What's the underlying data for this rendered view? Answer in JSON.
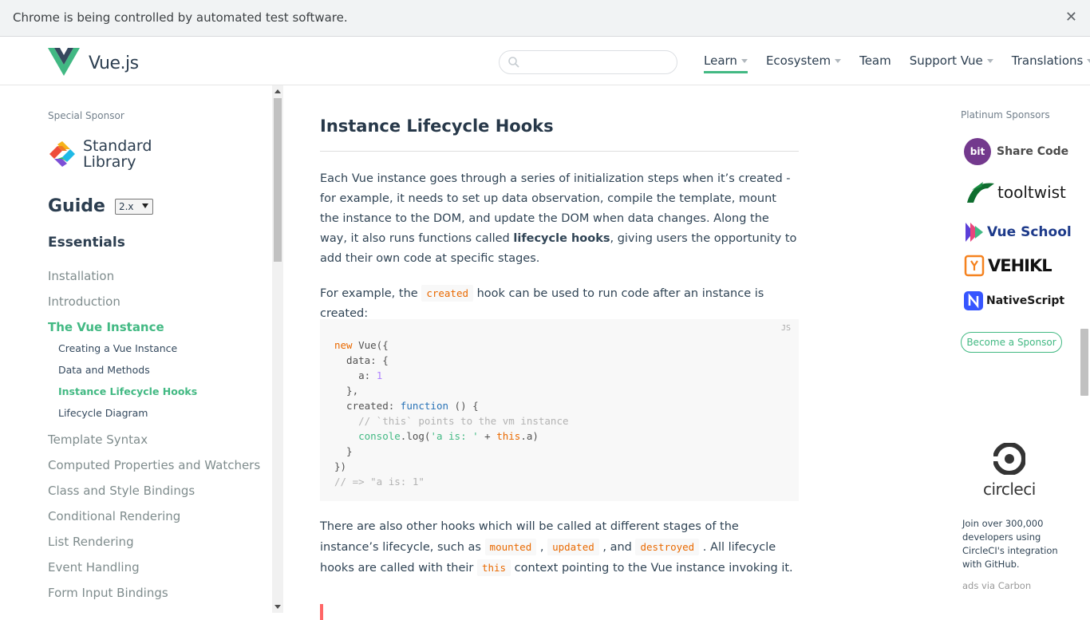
{
  "infobar": {
    "message": "Chrome is being controlled by automated test software.",
    "close_icon": "close-icon"
  },
  "header": {
    "brand": "Vue.js",
    "search": {
      "placeholder": "",
      "value": ""
    },
    "nav": [
      {
        "label": "Learn",
        "has_dropdown": true,
        "active": true
      },
      {
        "label": "Ecosystem",
        "has_dropdown": true
      },
      {
        "label": "Team",
        "has_dropdown": false
      },
      {
        "label": "Support Vue",
        "has_dropdown": true
      },
      {
        "label": "Translations",
        "has_dropdown": true
      }
    ]
  },
  "sidebar": {
    "special_sponsor_label": "Special Sponsor",
    "sponsor_name_line1": "Standard",
    "sponsor_name_line2": "Library",
    "guide_title": "Guide",
    "version": "2.x",
    "section_title": "Essentials",
    "items": [
      {
        "label": "Installation"
      },
      {
        "label": "Introduction"
      },
      {
        "label": "The Vue Instance",
        "active": true,
        "children": [
          {
            "label": "Creating a Vue Instance"
          },
          {
            "label": "Data and Methods"
          },
          {
            "label": "Instance Lifecycle Hooks",
            "active": true
          },
          {
            "label": "Lifecycle Diagram"
          }
        ]
      },
      {
        "label": "Template Syntax"
      },
      {
        "label": "Computed Properties and Watchers"
      },
      {
        "label": "Class and Style Bindings"
      },
      {
        "label": "Conditional Rendering"
      },
      {
        "label": "List Rendering"
      },
      {
        "label": "Event Handling"
      },
      {
        "label": "Form Input Bindings"
      }
    ]
  },
  "content": {
    "heading": "Instance Lifecycle Hooks",
    "para1_a": "Each Vue instance goes through a series of initialization steps when it’s created - for example, it needs to set up data observation, compile the template, mount the instance to the DOM, and update the DOM when data changes. Along the way, it also runs functions called ",
    "para1_bold": "lifecycle hooks",
    "para1_b": ", giving users the opportunity to add their own code at specific stages.",
    "para2_a": "For example, the ",
    "para2_code": "created",
    "para2_b": " hook can be used to run code after an instance is created:",
    "code_lang": "JS",
    "code": {
      "l1_kw": "new",
      "l1_rest": " Vue({",
      "l2": "  data: {",
      "l3_pre": "    a: ",
      "l3_num": "1",
      "l4": "  },",
      "l5_pre": "  created: ",
      "l5_fn": "function",
      "l5_rest": " () {",
      "l6": "    // `this` points to the vm instance",
      "l7_pre": "    ",
      "l7_fn": "console",
      "l7_mid": ".log(",
      "l7_str": "'a is: '",
      "l7_plus": " + ",
      "l7_this": "this",
      "l7_end": ".a)",
      "l8": "  }",
      "l9": "})",
      "l10": "// => \"a is: 1\""
    },
    "para3_a": "There are also other hooks which will be called at different stages of the instance’s lifecycle, such as ",
    "para3_c1": "mounted",
    "para3_sep1": " , ",
    "para3_c2": "updated",
    "para3_sep2": " , and ",
    "para3_c3": "destroyed",
    "para3_b": " . All lifecycle hooks are called with their ",
    "para3_c4": "this",
    "para3_c": " context pointing to the Vue instance invoking it."
  },
  "right": {
    "platinum_label": "Platinum Sponsors",
    "sponsors": [
      {
        "name": "Share Code",
        "badge": "bit",
        "color": "#73398d"
      },
      {
        "name": "tooltwist",
        "color": "#0f6e2f"
      },
      {
        "name": "Vue School",
        "color": "#1d3a8a"
      },
      {
        "name": "VEHIKL",
        "color": "#111111"
      },
      {
        "name": "NativeScript",
        "color": "#3655ff"
      }
    ],
    "become_sponsor": "Become a Sponsor",
    "ad_brand": "circleci",
    "ad_text": "Join over 300,000 developers using CircleCI's integration with GitHub.",
    "ad_via": "ads via Carbon"
  },
  "colors": {
    "accent": "#42b983",
    "code_orange": "#e96900"
  }
}
